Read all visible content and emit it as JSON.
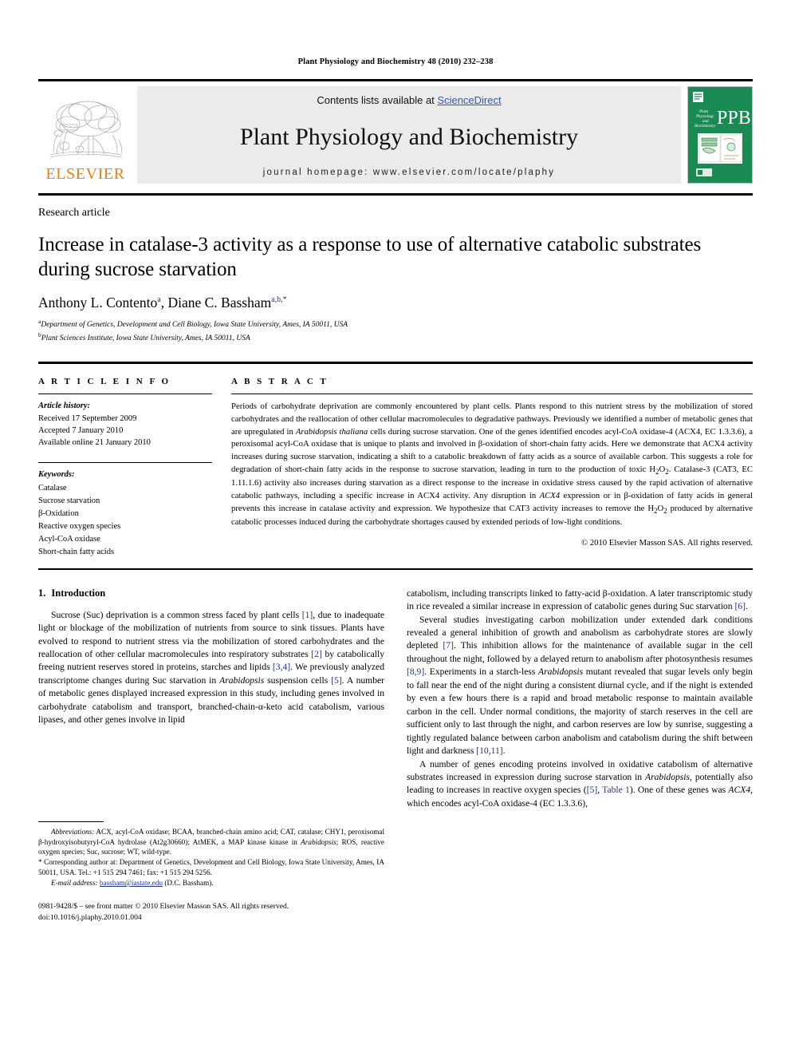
{
  "running_head": "Plant Physiology and Biochemistry 48 (2010) 232–238",
  "masthead": {
    "publisher_name": "ELSEVIER",
    "contents_prefix": "Contents lists available at ",
    "contents_link": "ScienceDirect",
    "journal_title": "Plant Physiology and Biochemistry",
    "homepage": "journal homepage: www.elsevier.com/locate/plaphy",
    "cover_abbrev": "PPB",
    "cover_title_lines": [
      "Plant",
      "Physiology",
      "and",
      "Biochemistry"
    ],
    "colors": {
      "elsevier_orange": "#F08000",
      "link_blue": "#3355bb",
      "cover_green": "#1a8a53",
      "banner_gray": "#ebebeb"
    }
  },
  "article_type": "Research article",
  "title": "Increase in catalase-3 activity as a response to use of alternative catabolic substrates during sucrose starvation",
  "authors": [
    {
      "name": "Anthony L. Contento",
      "marks": "a"
    },
    {
      "name": "Diane C. Bassham",
      "marks": "a,b,*"
    }
  ],
  "authors_separator": ", ",
  "affiliations": [
    {
      "mark": "a",
      "text": "Department of Genetics, Development and Cell Biology, Iowa State University, Ames, IA 50011, USA"
    },
    {
      "mark": "b",
      "text": "Plant Sciences Institute, Iowa State University, Ames, IA 50011, USA"
    }
  ],
  "article_info": {
    "heading": "A R T I C L E   I N F O",
    "history_label": "Article history:",
    "history": [
      "Received 17 September 2009",
      "Accepted 7 January 2010",
      "Available online 21 January 2010"
    ],
    "keywords_label": "Keywords:",
    "keywords": [
      "Catalase",
      "Sucrose starvation",
      "β-Oxidation",
      "Reactive oxygen species",
      "Acyl-CoA oxidase",
      "Short-chain fatty acids"
    ]
  },
  "abstract": {
    "heading": "A B S T R A C T",
    "paragraph_parts": [
      {
        "t": "Periods of carbohydrate deprivation are commonly encountered by plant cells. Plants respond to this nutrient stress by the mobilization of stored carbohydrates and the reallocation of other cellular macromolecules to degradative pathways. Previously we identified a number of metabolic genes that are upregulated in "
      },
      {
        "t": "Arabidopsis thaliana",
        "s": "it"
      },
      {
        "t": " cells during sucrose starvation. One of the genes identified encodes acyl-CoA oxidase-4 (ACX4, EC 1.3.3.6), a peroxisomal acyl-CoA oxidase that is unique to plants and involved in β-oxidation of short-chain fatty acids. Here we demonstrate that ACX4 activity increases during sucrose starvation, indicating a shift to a catabolic breakdown of fatty acids as a source of available carbon. This suggests a role for degradation of short-chain fatty acids in the response to sucrose starvation, leading in turn to the production of toxic H"
      },
      {
        "t": "2",
        "s": "sub"
      },
      {
        "t": "O"
      },
      {
        "t": "2",
        "s": "sub"
      },
      {
        "t": ". Catalase-3 (CAT3, EC 1.11.1.6) activity also increases during starvation as a direct response to the increase in oxidative stress caused by the rapid activation of alternative catabolic pathways, including a specific increase in ACX4 activity. Any disruption in "
      },
      {
        "t": "ACX4",
        "s": "it"
      },
      {
        "t": " expression or in β-oxidation of fatty acids in general prevents this increase in catalase activity and expression. We hypothesize that CAT3 activity increases to remove the H"
      },
      {
        "t": "2",
        "s": "sub"
      },
      {
        "t": "O"
      },
      {
        "t": "2",
        "s": "sub"
      },
      {
        "t": " produced by alternative catabolic processes induced during the carbohydrate shortages caused by extended periods of low-light conditions."
      }
    ],
    "copyright": "© 2010 Elsevier Masson SAS. All rights reserved."
  },
  "intro": {
    "number": "1.",
    "heading": "Introduction",
    "left_paragraph_parts": [
      {
        "t": "Sucrose (Suc) deprivation is a common stress faced by plant cells "
      },
      {
        "t": "[1]",
        "s": "ref"
      },
      {
        "t": ", due to inadequate light or blockage of the mobilization of nutrients from source to sink tissues. Plants have evolved to respond to nutrient stress via the mobilization of stored carbohydrates and the reallocation of other cellular macromolecules into respiratory substrates "
      },
      {
        "t": "[2]",
        "s": "ref"
      },
      {
        "t": " by catabolically freeing nutrient reserves stored in proteins, starches and lipids "
      },
      {
        "t": "[3,4]",
        "s": "ref"
      },
      {
        "t": ". We previously analyzed transcriptome changes during Suc starvation in "
      },
      {
        "t": "Arabidopsis",
        "s": "it"
      },
      {
        "t": " suspension cells "
      },
      {
        "t": "[5]",
        "s": "ref"
      },
      {
        "t": ". A number of metabolic genes displayed increased expression in this study, including genes involved in carbohydrate catabolism and transport, branched-chain-α-keto acid catabolism, various lipases, and other genes involve in lipid"
      }
    ],
    "right_paragraph1_parts": [
      {
        "t": "catabolism, including transcripts linked to fatty-acid β-oxidation. A later transcriptomic study in rice revealed a similar increase in expression of catabolic genes during Suc starvation "
      },
      {
        "t": "[6]",
        "s": "ref"
      },
      {
        "t": "."
      }
    ],
    "right_paragraph2_parts": [
      {
        "t": "Several studies investigating carbon mobilization under extended dark conditions revealed a general inhibition of growth and anabolism as carbohydrate stores are slowly depleted "
      },
      {
        "t": "[7]",
        "s": "ref"
      },
      {
        "t": ". This inhibition allows for the maintenance of available sugar in the cell throughout the night, followed by a delayed return to anabolism after photosynthesis resumes "
      },
      {
        "t": "[8,9]",
        "s": "ref"
      },
      {
        "t": ". Experiments in a starch-less "
      },
      {
        "t": "Arabidopsis",
        "s": "it"
      },
      {
        "t": " mutant revealed that sugar levels only begin to fall near the end of the night during a consistent diurnal cycle, and if the night is extended by even a few hours there is a rapid and broad metabolic response to maintain available carbon in the cell. Under normal conditions, the majority of starch reserves in the cell are sufficient only to last through the night, and carbon reserves are low by sunrise, suggesting a tightly regulated balance between carbon anabolism and catabolism during the shift between light and darkness "
      },
      {
        "t": "[10,11]",
        "s": "ref"
      },
      {
        "t": "."
      }
    ],
    "right_paragraph3_parts": [
      {
        "t": "A number of genes encoding proteins involved in oxidative catabolism of alternative substrates increased in expression during sucrose starvation in "
      },
      {
        "t": "Arabidopsis",
        "s": "it"
      },
      {
        "t": ", potentially also leading to increases in reactive oxygen species ("
      },
      {
        "t": "[5]",
        "s": "ref"
      },
      {
        "t": ", "
      },
      {
        "t": "Table 1",
        "s": "ref"
      },
      {
        "t": "). One of these genes was "
      },
      {
        "t": "ACX4",
        "s": "it"
      },
      {
        "t": ", which encodes acyl-CoA oxidase-4 (EC 1.3.3.6),"
      }
    ]
  },
  "footnotes": {
    "abbreviations_parts": [
      {
        "t": "Abbreviations:",
        "s": "it"
      },
      {
        "t": " ACX, acyl-CoA oxidase; BCAA, branched-chain amino acid; CAT, catalase; CHY1, peroxisomal β-hydroxyisobutyryl-CoA hydrolase (At2g30660); AtMEK, a MAP kinase kinase in "
      },
      {
        "t": "Arabidopsis",
        "s": "it"
      },
      {
        "t": "; ROS, reactive oxygen species; Suc, sucrose; WT, wild-type."
      }
    ],
    "corresponding": "* Corresponding author at: Department of Genetics, Development and Cell Biology, Iowa State University, Ames, IA 50011, USA. Tel.: +1 515 294 7461; fax: +1 515 294 5256.",
    "email_label": "E-mail address:",
    "email": "bassham@iastate.edu",
    "email_suffix": " (D.C. Bassham).",
    "issn_line": "0981-9428/$ – see front matter © 2010 Elsevier Masson SAS. All rights reserved.",
    "doi_line": "doi:10.1016/j.plaphy.2010.01.004"
  }
}
